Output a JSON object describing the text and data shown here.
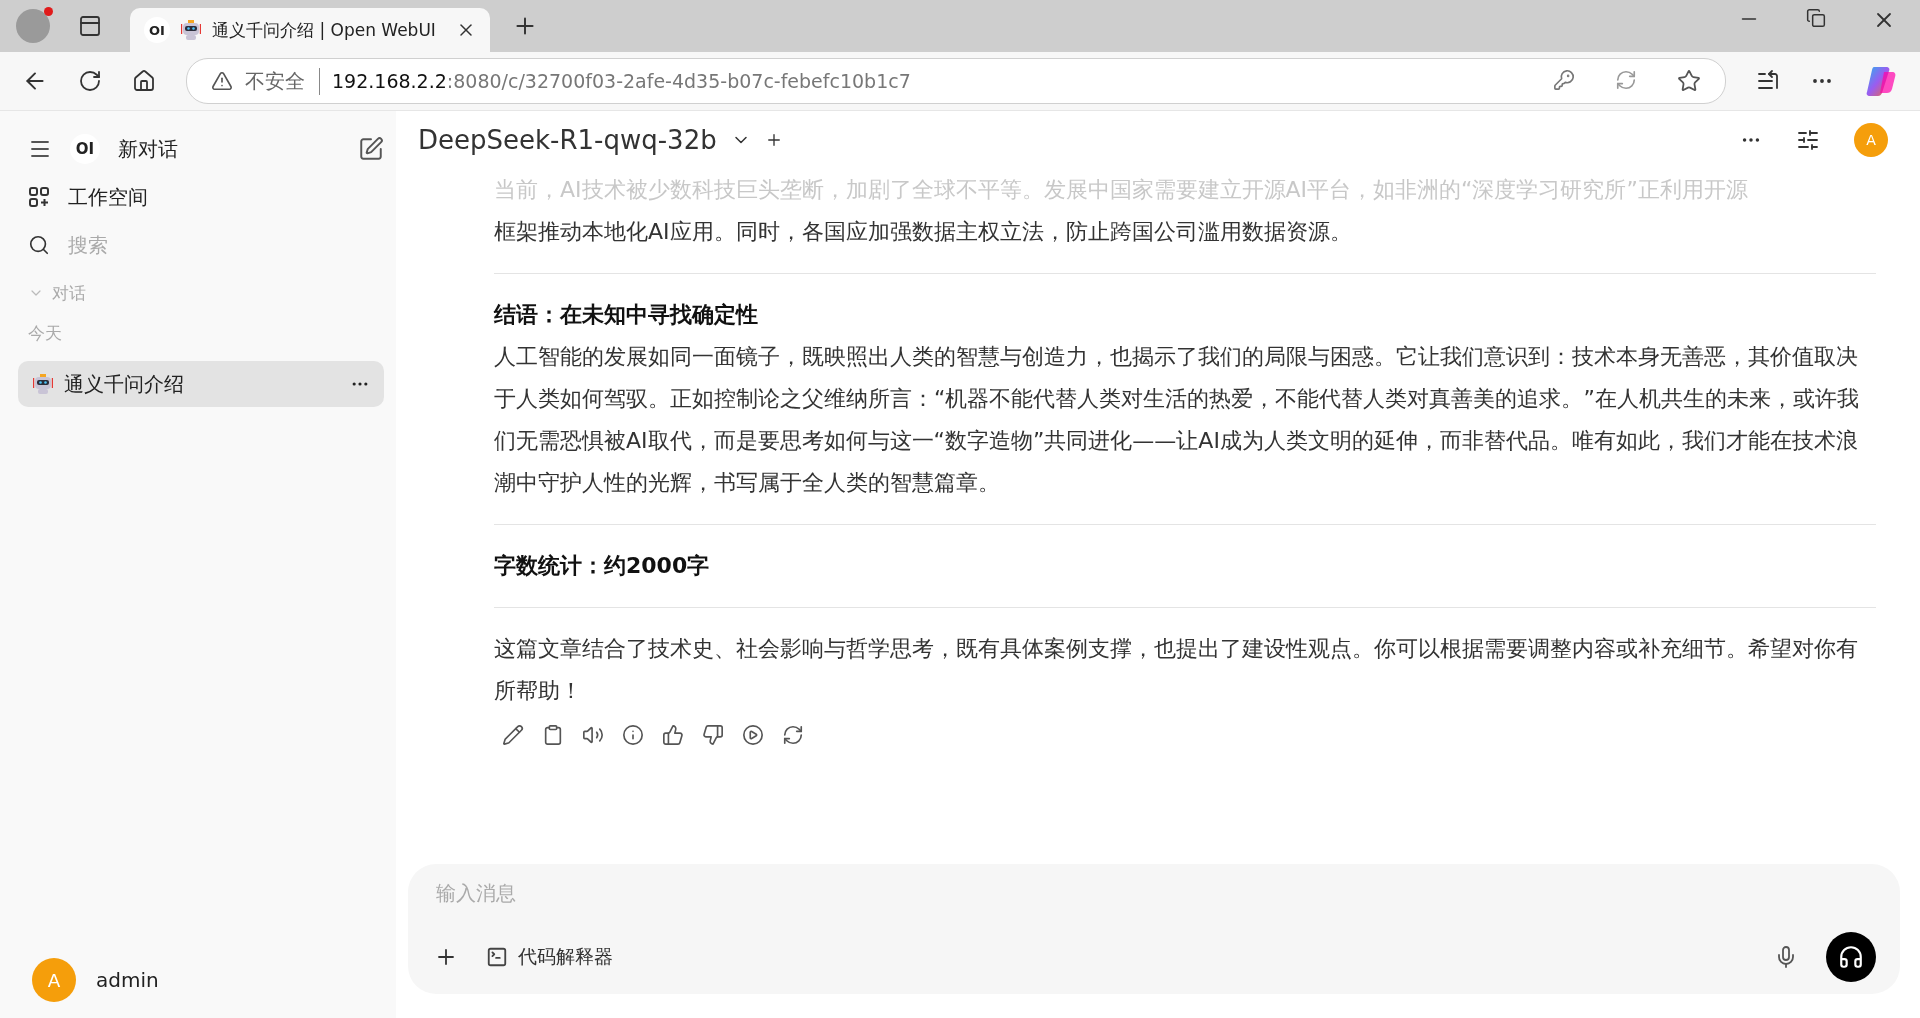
{
  "browser": {
    "tab_title": "通义千问介绍 | Open WebUI",
    "tab_logo": "OI",
    "security": "不安全",
    "url_host": "192.168.2.2",
    "url_rest": ":8080/c/32700f03-2afe-4d35-b07c-febefc10b1c7"
  },
  "sidebar": {
    "logo": "OI",
    "new_chat": "新对话",
    "workspace": "工作空间",
    "search_placeholder": "搜索",
    "section": "对话",
    "section_expanded": true,
    "group": "今天",
    "chats": [
      {
        "title": "通义千问介绍",
        "selected": true
      }
    ],
    "user": {
      "avatar": "A",
      "name": "admin"
    }
  },
  "header": {
    "model": "DeepSeek-R1-qwq-32b",
    "avatar": "A"
  },
  "message": {
    "blocks": [
      {
        "kind": "faded",
        "text": "当前，AI技术被少数科技巨头垄断，加剧了全球不平等。发展中国家需要建立开源AI平台，如非洲的“深度学习研究所”正利用开源"
      },
      {
        "kind": "paragraph",
        "text": "框架推动本地化AI应用。同时，各国应加强数据主权立法，防止跨国公司滥用数据资源。"
      },
      {
        "kind": "divider"
      },
      {
        "kind": "heading",
        "text": "结语：在未知中寻找确定性"
      },
      {
        "kind": "paragraph",
        "text": "人工智能的发展如同一面镜子，既映照出人类的智慧与创造力，也揭示了我们的局限与困惑。它让我们意识到：技术本身无善恶，其价值取决于人类如何驾驭。正如控制论之父维纳所言：“机器不能代替人类对生活的热爱，不能代替人类对真善美的追求。”在人机共生的未来，或许我们无需恐惧被AI取代，而是要思考如何与这一“数字造物”共同进化——让AI成为人类文明的延伸，而非替代品。唯有如此，我们才能在技术浪潮中守护人性的光辉，书写属于全人类的智慧篇章。"
      },
      {
        "kind": "divider"
      },
      {
        "kind": "heading",
        "text": "字数统计：约2000字"
      },
      {
        "kind": "divider"
      },
      {
        "kind": "paragraph",
        "text": "这篇文章结合了技术史、社会影响与哲学思考，既有具体案例支撑，也提出了建设性观点。你可以根据需要调整内容或补充细节。希望对你有所帮助！"
      }
    ]
  },
  "input": {
    "placeholder": "输入消息",
    "tool": "代码解释器"
  }
}
